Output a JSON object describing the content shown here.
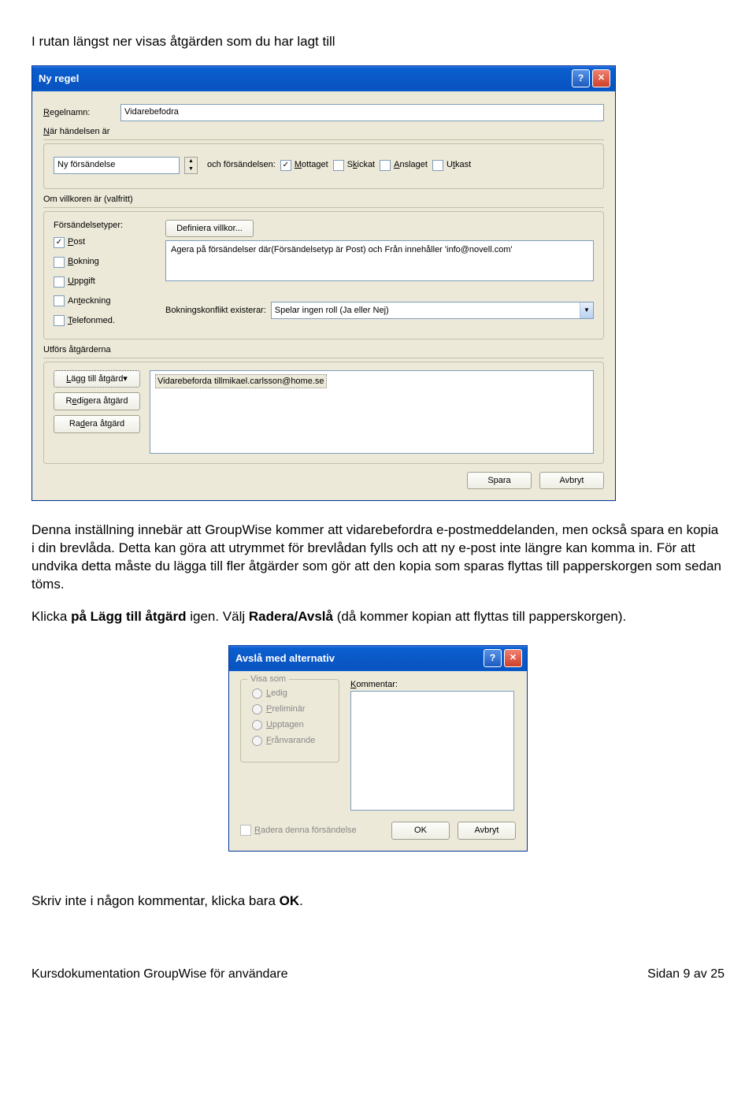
{
  "doc": {
    "intro_line": "I rutan längst ner visas åtgärden som du har lagt till",
    "para1_a": "Denna inställning innebär att GroupWise kommer att vidarebefordra e-postmeddelanden, men också spara en kopia i din brevlåda. Detta kan göra att utrymmet för brevlådan fylls och att ny e-post inte längre kan komma in. För att undvika detta måste du lägga till fler åtgärder som gör att den kopia som sparas flyttas till papperskorgen som sedan töms.",
    "para2_a": "Klicka ",
    "para2_b": "på Lägg till åtgärd",
    "para2_c": " igen. Välj ",
    "para2_d": "Radera/Avslå",
    "para2_e": " (då kommer kopian att flyttas till papperskorgen).",
    "para3_a": "Skriv inte i någon kommentar, klicka bara ",
    "para3_b": "OK",
    "para3_c": ".",
    "footer_left": "Kursdokumentation GroupWise för användare",
    "footer_right": "Sidan 9 av 25"
  },
  "dlg1": {
    "title": "Ny regel",
    "lbl_regelnamn": "Regelnamn:",
    "val_regelnamn": "Vidarebefodra",
    "hdr_nar": "När händelsen är",
    "combo_event": "Ny försändelse",
    "lbl_ochfors": "och försändelsen:",
    "chk_mottaget": "Mottaget",
    "chk_skickat": "Skickat",
    "chk_anslaget": "Anslaget",
    "chk_utkast": "Utkast",
    "hdr_om": "Om villkoren är (valfritt)",
    "lbl_forstyper": "Försändelsetyper:",
    "btn_definiera": "Definiera villkor...",
    "txt_agera": "Agera på försändelser där(Försändelsetyp är Post) och Från  innehåller 'info@novell.com'",
    "chk_post": "Post",
    "chk_bokning": "Bokning",
    "chk_uppgift": "Uppgift",
    "chk_anteckning": "Anteckning",
    "chk_telefon": "Telefonmed.",
    "lbl_konflikt": "Bokningskonflikt existerar:",
    "combo_konflikt": "Spelar ingen roll (Ja eller Nej)",
    "hdr_utf": "Utförs åtgärderna",
    "btn_lagg": "Lägg till åtgärd",
    "btn_redigera": "Redigera åtgärd",
    "btn_radera": "Radera åtgärd",
    "list_item": "Vidarebeforda tillmikael.carlsson@home.se",
    "btn_spara": "Spara",
    "btn_avbryt": "Avbryt"
  },
  "dlg2": {
    "title": "Avslå med alternativ",
    "legend_visa": "Visa som",
    "r_ledig": "Ledig",
    "r_prelim": "Preliminär",
    "r_upptagen": "Upptagen",
    "r_franv": "Frånvarande",
    "lbl_kommentar": "Kommentar:",
    "chk_radera": "Radera denna försändelse",
    "btn_ok": "OK",
    "btn_avbryt": "Avbryt"
  }
}
